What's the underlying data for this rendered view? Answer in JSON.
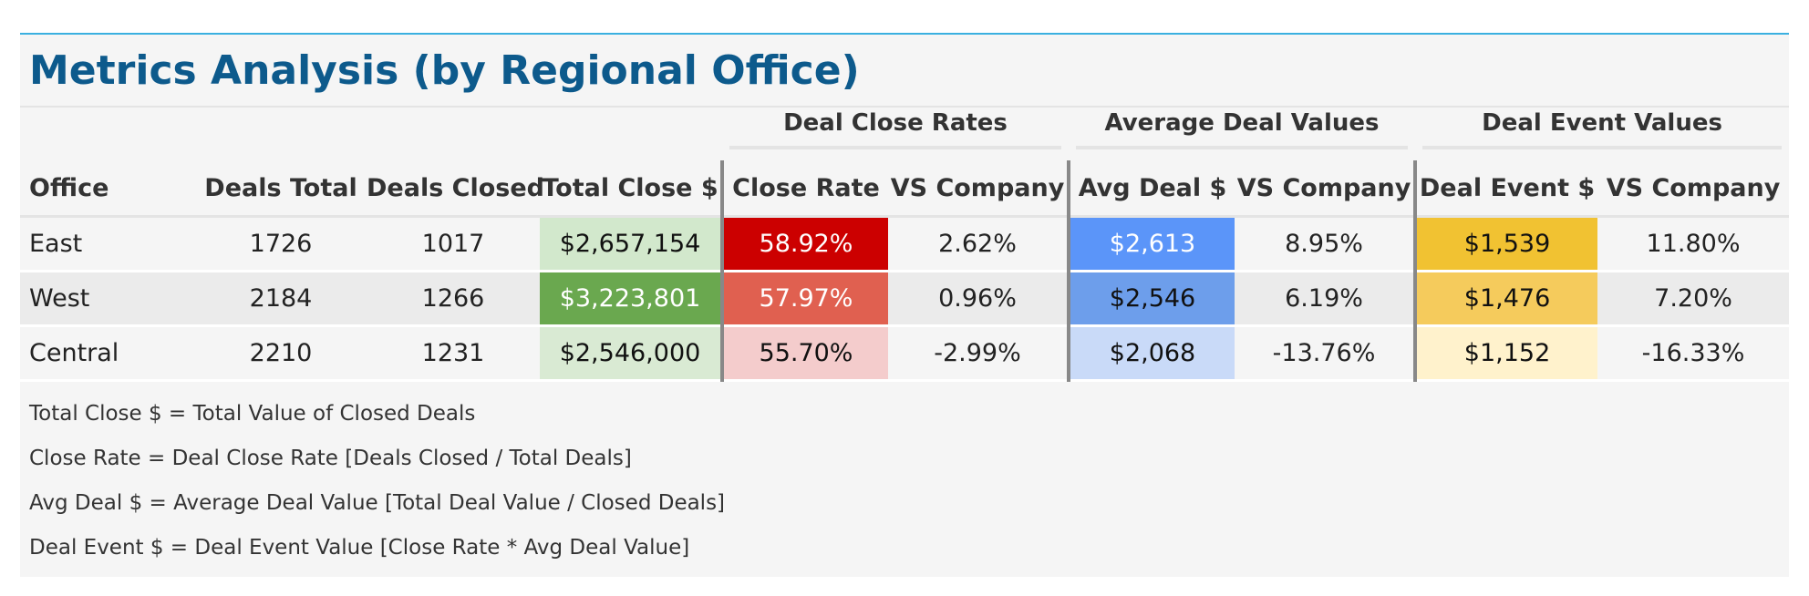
{
  "title": "Metrics Analysis (by Regional Office)",
  "groups": {
    "close_rates": "Deal Close Rates",
    "avg_values": "Average Deal Values",
    "event_values": "Deal Event Values"
  },
  "headers": [
    "Office",
    "Deals Total",
    "Deals Closed",
    "Total Close $",
    "Close Rate",
    "VS Company",
    "Avg Deal $",
    "VS Company",
    "Deal Event $",
    "VS Company"
  ],
  "rows": [
    [
      "East",
      "1726",
      "1017",
      "$2,657,154",
      "58.92%",
      "2.62%",
      "$2,613",
      "8.95%",
      "$1,539",
      "11.80%"
    ],
    [
      "West",
      "2184",
      "1266",
      "$3,223,801",
      "57.97%",
      "0.96%",
      "$2,546",
      "6.19%",
      "$1,476",
      "7.20%"
    ],
    [
      "Central",
      "2210",
      "1231",
      "$2,546,000",
      "55.70%",
      "-2.99%",
      "$2,068",
      "-13.76%",
      "$1,152",
      "-16.33%"
    ]
  ],
  "cell_colors": {
    "total_close": [
      "#d2e8cc",
      "#6aa84f",
      "#d9ead3"
    ],
    "close_rate": [
      "#cc0000",
      "#e06050",
      "#f4cccc"
    ],
    "avg_deal": [
      "#5b95f9",
      "#6d9eeb",
      "#c9daf8"
    ],
    "deal_event": [
      "#f1c232",
      "#f5cb5c",
      "#fff2cc"
    ]
  },
  "notes": [
    "Total Close $ = Total Value of Closed Deals",
    "Close Rate = Deal Close Rate [Deals Closed / Total Deals]",
    "Avg Deal $ = Average Deal Value [Total Deal Value / Closed Deals]",
    "Deal Event $ = Deal Event Value [Close Rate * Avg Deal Value]"
  ]
}
